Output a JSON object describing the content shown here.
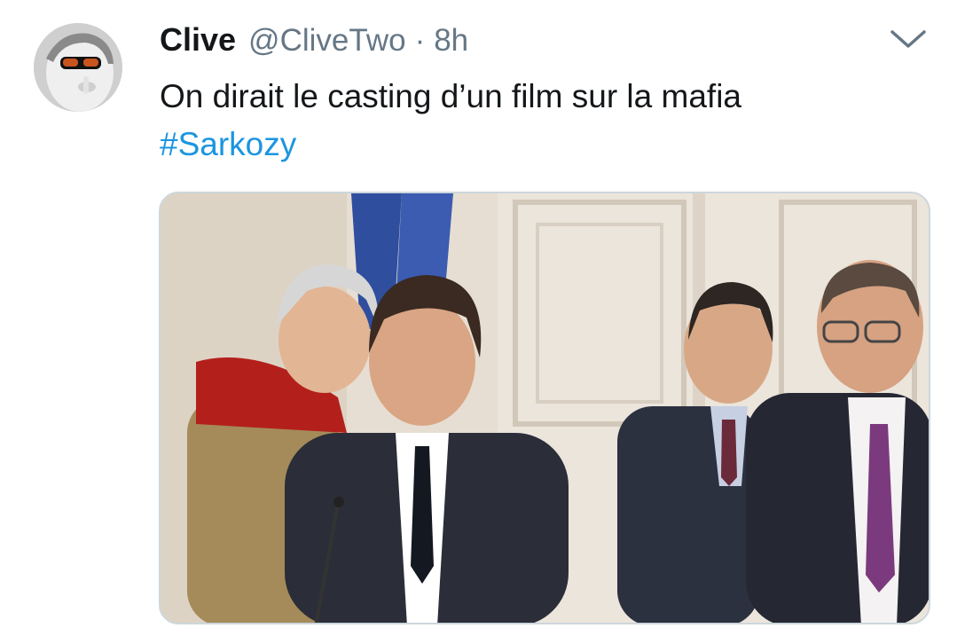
{
  "tweet": {
    "author_name": "Clive",
    "handle": "@CliveTwo",
    "separator": "·",
    "time": "8h",
    "text": "On dirait le casting d’un film sur la mafia",
    "hashtag": "#Sarkozy",
    "media_description": "photo-of-five-people-in-suits",
    "icons": {
      "menu": "chevron-down-icon"
    }
  },
  "colors": {
    "name": "#14171a",
    "secondary": "#657786",
    "hashtag": "#1b95e0",
    "media_border": "#ccd6dd"
  }
}
